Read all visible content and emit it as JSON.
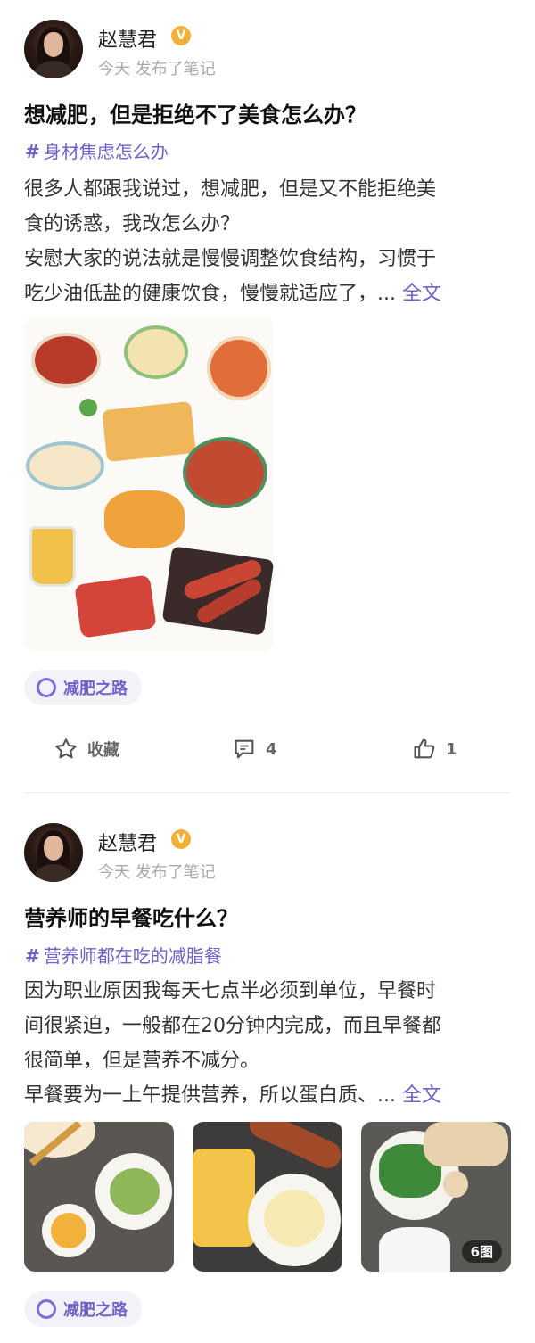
{
  "posts": [
    {
      "author": "赵慧君",
      "meta": "今天 发布了笔记",
      "title": "想减肥，但是拒绝不了美食怎么办？",
      "topic": "身材焦虑怎么办",
      "body_lines": [
        "很多人都跟我说过，想减肥，但是又不能拒绝美",
        "食的诱惑，我改怎么办？",
        "安慰大家的说法就是慢慢调整饮食结构，习惯于",
        "吃少油低盐的健康饮食，慢慢就适应了，..."
      ],
      "more_label": "全文",
      "circle": "减肥之路",
      "actions": {
        "collect_label": "收藏",
        "comment_count": "4",
        "like_count": "1"
      }
    },
    {
      "author": "赵慧君",
      "meta": "今天 发布了笔记",
      "title": "营养师的早餐吃什么？",
      "topic": "营养师都在吃的减脂餐",
      "body_lines": [
        "因为职业原因我每天七点半必须到单位，早餐时",
        "间很紧迫，一般都在20分钟内完成，而且早餐都",
        "很简单，但是营养不减分。",
        "早餐要为一上午提供营养，所以蛋白质、..."
      ],
      "more_label": "全文",
      "image_count_badge": "6图",
      "circle": "减肥之路"
    }
  ],
  "colors": {
    "accent": "#6f62c9",
    "verified": "#f2b136",
    "meta_text": "#aaaaaa"
  },
  "icons": [
    "verified-icon",
    "hash-icon",
    "circle-bubble-icon",
    "star-icon",
    "comment-icon",
    "thumbs-up-icon"
  ]
}
